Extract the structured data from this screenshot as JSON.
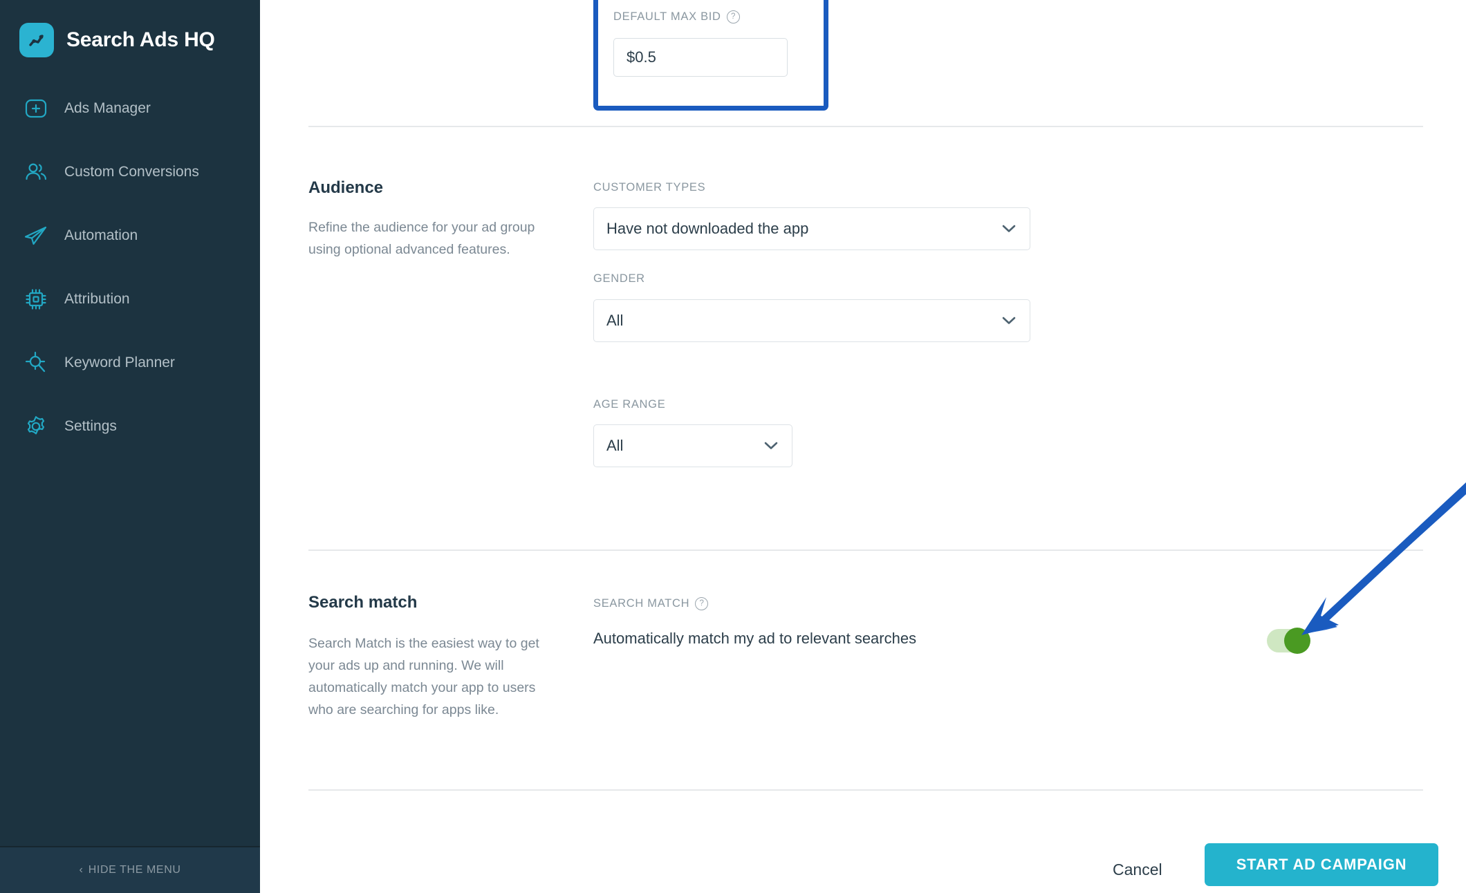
{
  "sidebar": {
    "brand": {
      "title": "Search Ads HQ",
      "logo_icon": "line-chart-icon",
      "logo_color": "#2bb3d1"
    },
    "items": [
      {
        "label": "Ads Manager",
        "icon": "plus-square-icon"
      },
      {
        "label": "Custom Conversions",
        "icon": "users-icon"
      },
      {
        "label": "Automation",
        "icon": "paper-plane-icon"
      },
      {
        "label": "Attribution",
        "icon": "chip-icon"
      },
      {
        "label": "Keyword Planner",
        "icon": "crosshair-search-icon"
      },
      {
        "label": "Settings",
        "icon": "gear-icon"
      }
    ],
    "hide_menu": {
      "label": "HIDE THE MENU",
      "chevron": "‹"
    },
    "background_color": "#1c3340"
  },
  "bid_block": {
    "label": "DEFAULT MAX BID",
    "help_icon": "question-mark-circle-icon",
    "value": "$0.5",
    "placeholder": "$0.00",
    "highlight_color": "#1a5bbf"
  },
  "audience": {
    "title": "Audience",
    "description": "Refine the audience for your ad group using optional advanced features.",
    "fields": [
      {
        "label": "CUSTOMER TYPES",
        "value": "Have not downloaded the app"
      },
      {
        "label": "GENDER",
        "value": "All"
      },
      {
        "label": "AGE RANGE",
        "value": "All"
      }
    ]
  },
  "search_match": {
    "title": "Search match",
    "description": "Search Match is the easiest way to get your ads up and running. We will automatically match your app to users who are searching for apps like.",
    "field_label": "SEARCH MATCH",
    "help_icon": "question-mark-circle-icon",
    "toggle_text": "Automatically match my ad to relevant searches",
    "toggle_state": "on",
    "toggle_on_color": "#4a9a22",
    "toggle_track_color": "#cfe7c2"
  },
  "footer": {
    "cancel_label": "Cancel",
    "start_label": "START AD CAMPAIGN",
    "start_color": "#24b3cd"
  },
  "annotation": {
    "arrow_color": "#1a5bbf",
    "points_to": "search-match-toggle"
  }
}
